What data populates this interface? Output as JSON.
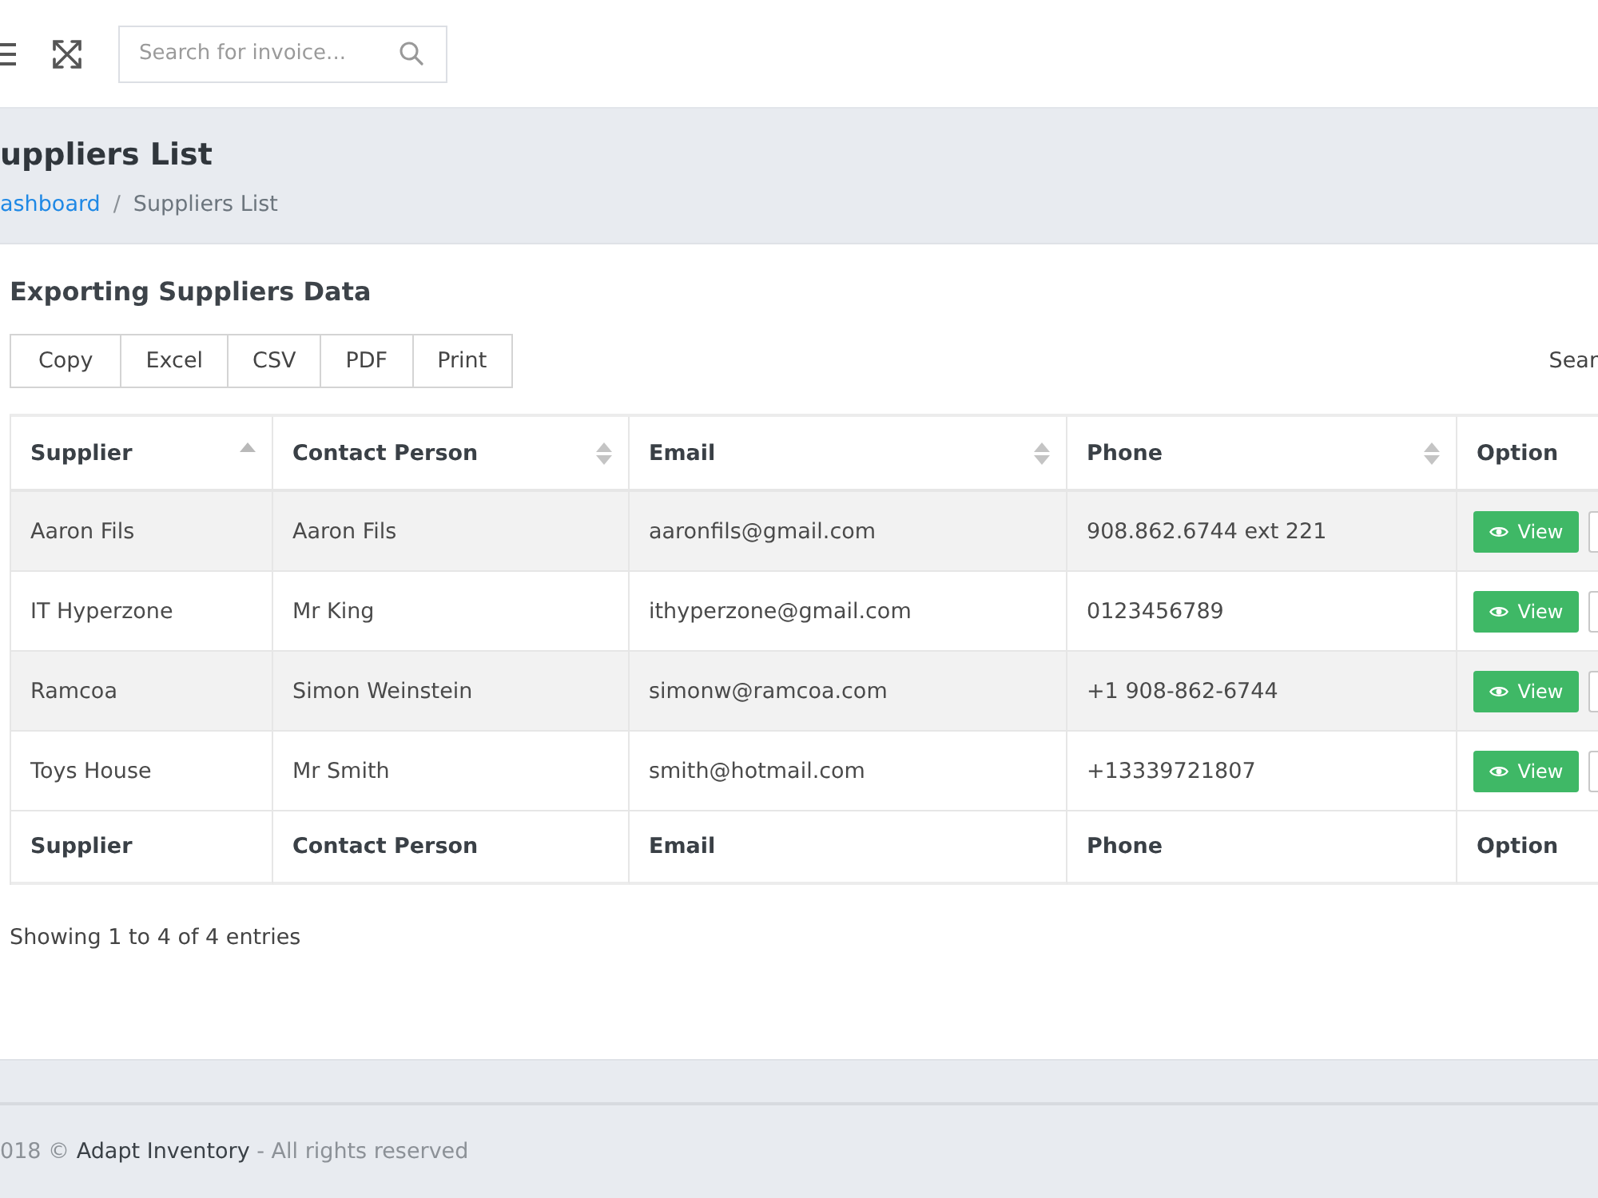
{
  "topbar": {
    "search": {
      "placeholder": "Search for invoice..."
    }
  },
  "page_header": {
    "title": "uppliers List",
    "breadcrumb": [
      {
        "label": "ashboard",
        "active": false
      },
      {
        "label": "Suppliers List",
        "active": true
      }
    ],
    "separator": "/"
  },
  "card": {
    "title": "Exporting Suppliers Data",
    "export_buttons": [
      "Copy",
      "Excel",
      "CSV",
      "PDF",
      "Print"
    ],
    "search_label": "Sear",
    "table": {
      "columns": [
        {
          "label": "Supplier",
          "sortable": true,
          "sorted": true
        },
        {
          "label": "Contact Person",
          "sortable": true,
          "sorted": false
        },
        {
          "label": "Email",
          "sortable": true,
          "sorted": false
        },
        {
          "label": "Phone",
          "sortable": true,
          "sorted": false
        },
        {
          "label": "Option",
          "sortable": false
        }
      ],
      "rows": [
        {
          "cells": [
            "Aaron Fils",
            "Aaron Fils",
            "aaronfils@gmail.com",
            "908.862.6744 ext 221"
          ],
          "action": "View"
        },
        {
          "cells": [
            "IT Hyperzone",
            "Mr King",
            "ithyperzone@gmail.com",
            "0123456789"
          ],
          "action": "View"
        },
        {
          "cells": [
            "Ramcoa",
            "Simon Weinstein",
            "simonw@ramcoa.com",
            "+1 908-862-6744"
          ],
          "action": "View"
        },
        {
          "cells": [
            "Toys House",
            "Mr Smith",
            "smith@hotmail.com",
            "+13339721807"
          ],
          "action": "View"
        }
      ],
      "footer": [
        "Supplier",
        "Contact Person",
        "Email",
        "Phone",
        "Option"
      ]
    },
    "info": "Showing 1 to 4 of 4 entries"
  },
  "footer": {
    "prefix": "018 ©",
    "link": "Adapt Inventory",
    "suffix": "- All rights reserved"
  }
}
